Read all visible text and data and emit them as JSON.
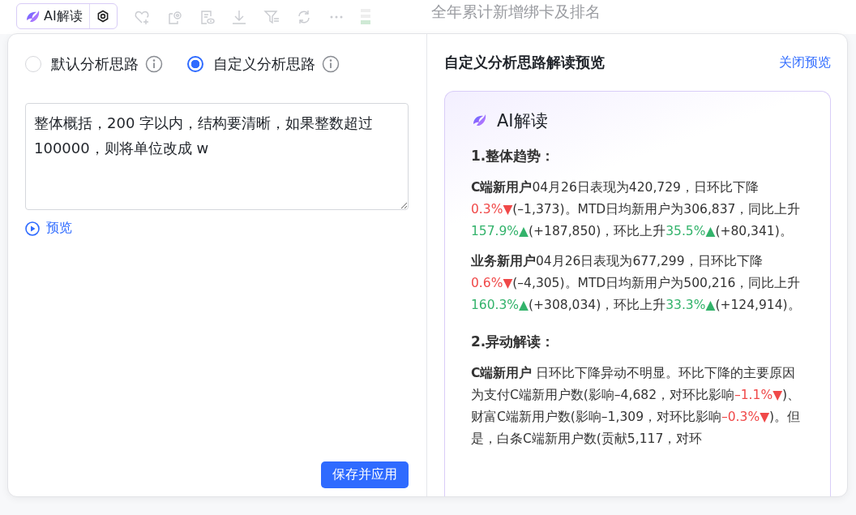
{
  "toolbar": {
    "ai_button": "AI解读"
  },
  "background_title": "全年累计新增绑卡及排名",
  "mode_options": [
    {
      "label": "默认分析思路",
      "selected": false
    },
    {
      "label": "自定义分析思路",
      "selected": true
    }
  ],
  "prompt": {
    "value": "整体概括，200 字以内，结构要清晰，如果整数超过 100000，则将单位改成 w"
  },
  "preview_link": "预览",
  "save_button": "保存并应用",
  "preview_panel": {
    "title": "自定义分析思路解读预览",
    "close_link": "关闭预览",
    "card_title": "AI解读",
    "sections": [
      {
        "heading": "1.整体趋势：",
        "paragraphs": [
          [
            {
              "kind": "bold",
              "text": "C端新用户"
            },
            {
              "kind": "text",
              "text": "04月26日表现为420,729，日环比下降"
            },
            {
              "kind": "down",
              "text": "0.3%▼"
            },
            {
              "kind": "text",
              "text": "(–1,373)。MTD日均新用户为306,837，同比上升"
            },
            {
              "kind": "up",
              "text": "157.9%▲"
            },
            {
              "kind": "text",
              "text": "(+187,850)，环比上升"
            },
            {
              "kind": "up",
              "text": "35.5%▲"
            },
            {
              "kind": "text",
              "text": "(+80,341)。"
            }
          ],
          [
            {
              "kind": "bold",
              "text": "业务新用户"
            },
            {
              "kind": "text",
              "text": "04月26日表现为677,299，日环比下降"
            },
            {
              "kind": "down",
              "text": "0.6%▼"
            },
            {
              "kind": "text",
              "text": "(–4,305)。MTD日均新用户为500,216，同比上升"
            },
            {
              "kind": "up",
              "text": "160.3%▲"
            },
            {
              "kind": "text",
              "text": "(+308,034)，环比上升"
            },
            {
              "kind": "up",
              "text": "33.3%▲"
            },
            {
              "kind": "text",
              "text": "(+124,914)。"
            }
          ]
        ]
      },
      {
        "heading": "2.异动解读：",
        "paragraphs": [
          [
            {
              "kind": "bold",
              "text": "C端新用户"
            },
            {
              "kind": "text",
              "text": " 日环比下降异动不明显。环比下降的主要原因为支付C端新用户数(影响–4,682，对环比影响"
            },
            {
              "kind": "down",
              "text": "–1.1%▼"
            },
            {
              "kind": "text",
              "text": ")、财富C端新用户数(影响–1,309，对环比影响"
            },
            {
              "kind": "down",
              "text": "–0.3%▼"
            },
            {
              "kind": "text",
              "text": ")。但是，白条C端新用户数(贡献5,117，对环"
            }
          ]
        ]
      }
    ]
  }
}
